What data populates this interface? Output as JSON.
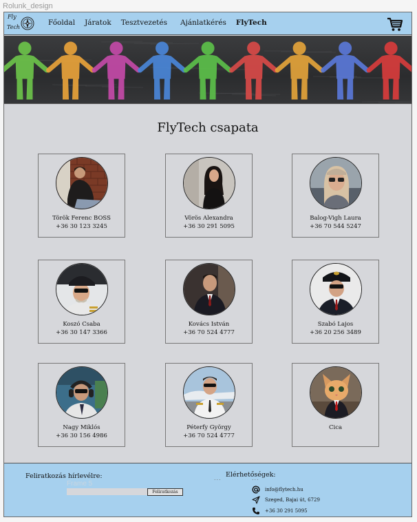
{
  "frame_label": "Rolunk_design",
  "logo": {
    "line1": "Fly",
    "line2": "Tech"
  },
  "nav": [
    {
      "label": "Főoldal"
    },
    {
      "label": "Járatok"
    },
    {
      "label": "Tesztvezetés"
    },
    {
      "label": "Ajánlatkérés"
    },
    {
      "label": "FlyTech",
      "active": true
    }
  ],
  "icons": {
    "cart": "cart-icon",
    "email": "at-icon",
    "address": "paper-plane-icon",
    "phone": "phone-icon",
    "logo": "compass-logo-icon"
  },
  "hero": {
    "figure_colors": [
      "#6cc34a",
      "#e8a23a",
      "#c44aa8",
      "#4a86d8",
      "#5cc04a",
      "#d84a48",
      "#e3a33a",
      "#5a78d8",
      "#d83c3c"
    ]
  },
  "title": "FlyTech csapata",
  "team": [
    {
      "name": "Török Ferenc BOSS",
      "phone": "+36 30 123 3245"
    },
    {
      "name": "Vörös Alexandra",
      "phone": "+36 30 291 5095"
    },
    {
      "name": "Balog-Vigh Laura",
      "phone": "+36 70 544 5247"
    },
    {
      "name": "Koszó Csaba",
      "phone": "+36 30 147 3366"
    },
    {
      "name": "Kovács István",
      "phone": "+36 70 524 4777"
    },
    {
      "name": "Szabó Lajos",
      "phone": "+36 20 256 3489"
    },
    {
      "name": "Nagy Miklós",
      "phone": "+36 30 156 4986"
    },
    {
      "name": "Péterfy György",
      "phone": "+36 70 524 4777"
    },
    {
      "name": "Cica",
      "phone": ""
    }
  ],
  "footer": {
    "newsletter_label": "Feliratkozás hírlevélre:",
    "frame_label": "Frame 5",
    "input_placeholder": "",
    "subscribe_button": "Feliratkozás",
    "contact_label": "Elérhetőségek:",
    "email": "info@flytech.hu",
    "address": "Szeged, Bajai út, 6729",
    "phone": "+36 30 291 5095"
  },
  "colors": {
    "header_bg": "#a6d0ee",
    "page_bg": "#d6d7db",
    "hero_bg": "#323335"
  }
}
